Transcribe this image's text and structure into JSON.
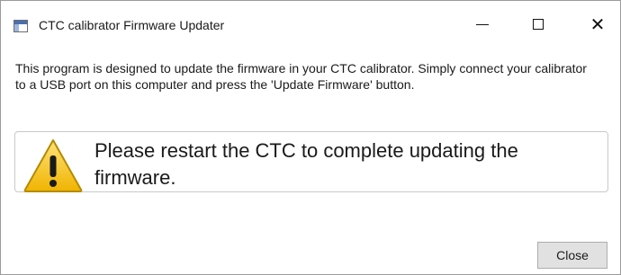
{
  "window": {
    "title": "CTC calibrator Firmware Updater"
  },
  "titlebar_buttons": {
    "minimize_icon": "minimize-icon",
    "maximize_icon": "maximize-icon",
    "close_icon": "close-icon",
    "close_glyph": "✕"
  },
  "main": {
    "description": "This program is designed to update the firmware in your CTC calibrator.  Simply connect your calibrator to a USB port on this computer and press the 'Update Firmware' button.",
    "message": "Please restart the CTC to complete updating the firmware.",
    "warning_icon": "warning-icon"
  },
  "footer": {
    "close_label": "Close"
  },
  "colors": {
    "warning_yellow": "#f5c518",
    "warning_border": "#b58a00",
    "button_bg": "#e1e1e1"
  }
}
